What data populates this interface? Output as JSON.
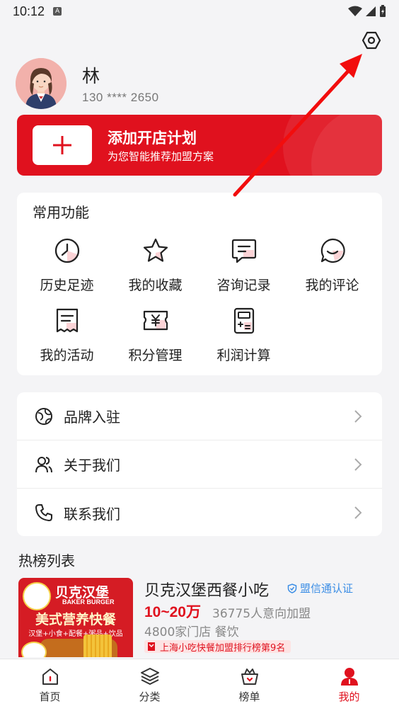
{
  "status_bar": {
    "time": "10:12",
    "notif_icon": "A"
  },
  "profile": {
    "name": "林",
    "phone": "130 **** 2650"
  },
  "plan_banner": {
    "title": "添加开店计划",
    "subtitle": "为您智能推荐加盟方案"
  },
  "common_functions": {
    "title": "常用功能",
    "items": [
      {
        "label": "历史足迹",
        "icon": "clock-icon"
      },
      {
        "label": "我的收藏",
        "icon": "star-icon"
      },
      {
        "label": "咨询记录",
        "icon": "chat-icon"
      },
      {
        "label": "我的评论",
        "icon": "comment-icon"
      },
      {
        "label": "我的活动",
        "icon": "activity-icon"
      },
      {
        "label": "积分管理",
        "icon": "points-icon"
      },
      {
        "label": "利润计算",
        "icon": "calculator-icon"
      }
    ]
  },
  "menu": [
    {
      "label": "品牌入驻",
      "icon": "globe-icon"
    },
    {
      "label": "关于我们",
      "icon": "users-icon"
    },
    {
      "label": "联系我们",
      "icon": "phone-icon"
    }
  ],
  "hot_list": {
    "title": "热榜列表",
    "item": {
      "name": "贝克汉堡西餐小吃",
      "certification": "盟信通认证",
      "investment": "10~20万",
      "intent": "36775人意向加盟",
      "stores": "4800家门店 餐饮",
      "rank": "上海小吃快餐加盟排行榜第9名",
      "image": {
        "brand_cn": "贝克汉堡",
        "brand_en": "BAKER BURGER",
        "slogan": "美式营养快餐",
        "menu_line": "汉堡+小食+配餐+粥品+饮品"
      }
    }
  },
  "tabbar": [
    {
      "label": "首页",
      "icon": "home-icon",
      "active": false
    },
    {
      "label": "分类",
      "icon": "layers-icon",
      "active": false
    },
    {
      "label": "榜单",
      "icon": "crown-basket-icon",
      "active": false
    },
    {
      "label": "我的",
      "icon": "person-icon",
      "active": true
    }
  ],
  "colors": {
    "brand_red": "#e0111e",
    "cert_blue": "#3a8de5",
    "background": "#f4f4f6"
  }
}
